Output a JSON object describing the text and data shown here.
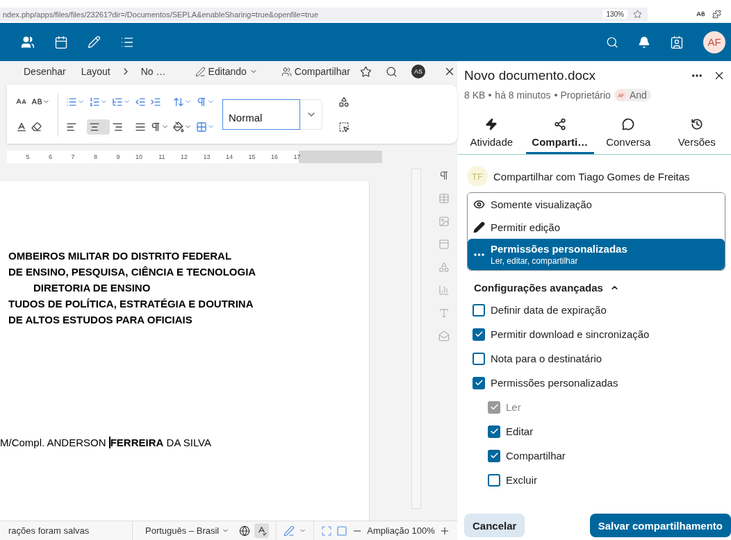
{
  "browser": {
    "url": "ndex.php/apps/files/files/23261?dir=/Documentos/SEPLA&enableSharing=true&openfile=true",
    "zoom": "130%"
  },
  "app_header": {
    "avatar": "AF"
  },
  "editor": {
    "menu": [
      "Desenhar",
      "Layout"
    ],
    "breadcrumb": "No …",
    "mode": "Editando",
    "share": "Compartilhar",
    "user_avatar": "AS",
    "alignments": [
      {
        "selected": false
      },
      {
        "selected": true
      },
      {
        "selected": false
      },
      {
        "selected": false
      }
    ],
    "style_value": "Normal",
    "ruler_marks": [
      "5",
      "6",
      "7",
      "8",
      "9",
      "10",
      "11",
      "12",
      "13",
      "14",
      "15",
      "16",
      "17"
    ],
    "document_lines": [
      {
        "text": "OMBEIROS MILITAR DO DISTRITO FEDERAL",
        "kind": "heading"
      },
      {
        "text": "DE ENSINO, PESQUISA, CIÊNCIA E TECNOLOGIA",
        "kind": "heading"
      },
      {
        "text": "DIRETORIA DE ENSINO",
        "kind": "indented"
      },
      {
        "text": "TUDOS DE POLÍTICA, ESTRATÉGIA E DOUTRINA",
        "kind": "heading"
      },
      {
        "text": "DE ALTOS ESTUDOS PARA OFICIAIS",
        "kind": "heading"
      },
      {
        "text": "M/Compl. ANDERSON **FERREIRA** DA SILVA",
        "kind": "signature"
      }
    ],
    "status": {
      "saved": "rações foram salvas",
      "language": "Português – Brasil",
      "zoom": "Ampliação 100%"
    }
  },
  "sidebar": {
    "title": "Novo documento.docx",
    "meta": [
      "8 KB",
      "há 8 minutos",
      "Proprietário"
    ],
    "owner": {
      "initials": "AF",
      "name": "And"
    },
    "tabs": [
      {
        "label": "Atividade",
        "selected": false
      },
      {
        "label": "Comparti…",
        "selected": true
      },
      {
        "label": "Conversa",
        "selected": false
      },
      {
        "label": "Versões",
        "selected": false
      }
    ],
    "share_with": {
      "initials": "TF",
      "label": "Compartilhar com Tiago Gomes de Freitas"
    },
    "permission_options": [
      {
        "label": "Somente visualização",
        "selected": false
      },
      {
        "label": "Permitir edição",
        "selected": false
      },
      {
        "label": "Permissões personalizadas",
        "sublabel": "Ler, editar, compartilhar",
        "selected": true
      }
    ],
    "advanced": {
      "label": "Configurações avançadas",
      "expanded": true
    },
    "options": [
      {
        "label": "Definir data de expiração",
        "checked": false,
        "disabled": false
      },
      {
        "label": "Permitir download e sincronização",
        "checked": true,
        "disabled": false
      },
      {
        "label": "Nota para o destinatário",
        "checked": false,
        "disabled": false
      },
      {
        "label": "Permissões personalizadas",
        "checked": true,
        "disabled": false,
        "children": [
          {
            "label": "Ler",
            "checked": true,
            "disabled": true
          },
          {
            "label": "Editar",
            "checked": true,
            "disabled": false
          },
          {
            "label": "Compartilhar",
            "checked": true,
            "disabled": false
          },
          {
            "label": "Excluir",
            "checked": false,
            "disabled": false
          }
        ]
      }
    ],
    "buttons": [
      "Cancelar",
      "Salvar compartilhamento"
    ]
  }
}
